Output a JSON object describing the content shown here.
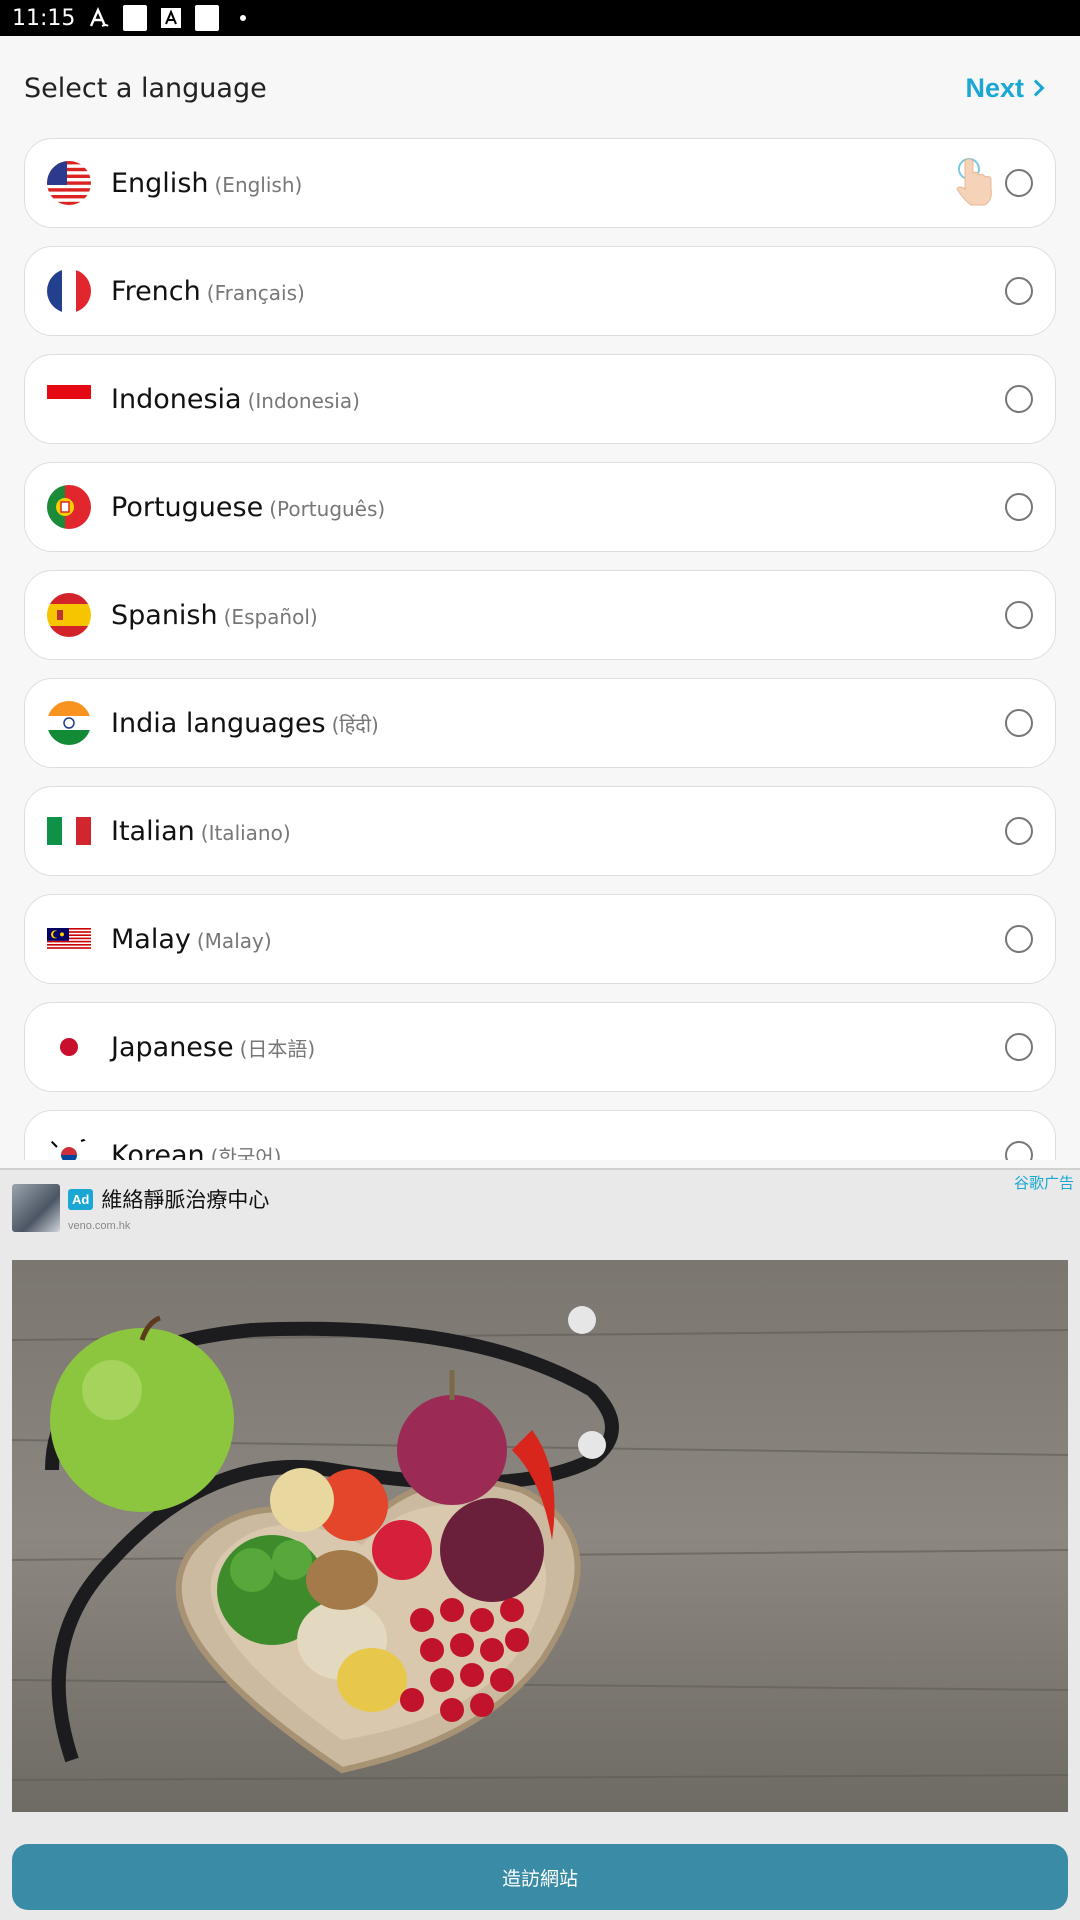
{
  "status_bar": {
    "time": "11:15"
  },
  "header": {
    "title": "Select a language",
    "next_label": "Next"
  },
  "languages": [
    {
      "name": "English",
      "native": "(English)",
      "flag": "us-flag-icon"
    },
    {
      "name": "French",
      "native": "(Français)",
      "flag": "fr-flag-icon"
    },
    {
      "name": "Indonesia",
      "native": "(Indonesia)",
      "flag": "id-flag-icon"
    },
    {
      "name": "Portuguese",
      "native": "(Português)",
      "flag": "pt-flag-icon"
    },
    {
      "name": "Spanish",
      "native": "(Español)",
      "flag": "es-flag-icon"
    },
    {
      "name": "India languages",
      "native": "(हिंदी)",
      "flag": "in-flag-icon"
    },
    {
      "name": "Italian",
      "native": "(Italiano)",
      "flag": "it-flag-icon"
    },
    {
      "name": "Malay",
      "native": "(Malay)",
      "flag": "my-flag-icon"
    },
    {
      "name": "Japanese",
      "native": "(日本語)",
      "flag": "jp-flag-icon"
    },
    {
      "name": "Korean",
      "native": "(한국어)",
      "flag": "kr-flag-icon"
    }
  ],
  "ad": {
    "badge": "Ad",
    "title": "維絡靜脈治療中心",
    "url": "veno.com.hk",
    "corner_label": "谷歌广告",
    "button_label": "造訪網站"
  },
  "colors": {
    "accent": "#1aa7d4",
    "ad_button": "#3a8ba6"
  }
}
